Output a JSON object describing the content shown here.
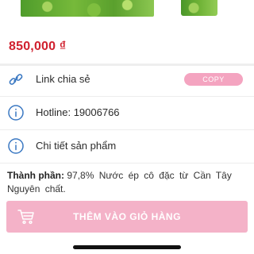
{
  "product": {
    "price": "850,000 ₫"
  },
  "info_rows": {
    "share_link_label": "Link chia sẻ",
    "copy_label": "COPY",
    "hotline_label": "Hotline: 19006766",
    "detail_label": "Chi tiết sản phẩm"
  },
  "ingredients": {
    "heading": "Thành phần:",
    "text": "97,8% Nước ép cô đặc từ Cần Tây Nguyên chất."
  },
  "cart": {
    "add_label": "THÊM VÀO GIỎ HÀNG"
  },
  "colors": {
    "price": "#d0202e",
    "icon_blue": "#3a78c2",
    "accent_pink": "#f4b2c8",
    "copy_pink": "#f4a4c0"
  },
  "icons": {
    "share": "link-icon",
    "hotline": "info-icon",
    "detail": "info-icon",
    "cart": "cart-icon"
  }
}
